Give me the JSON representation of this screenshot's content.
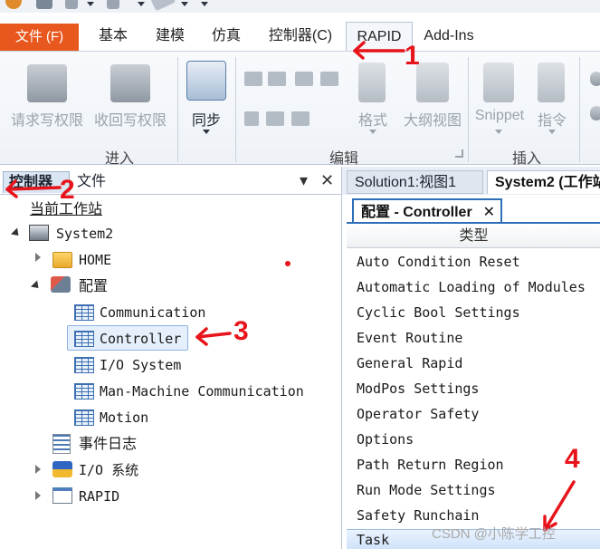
{
  "ribbon_tabs": {
    "file": "文件 (F)",
    "home": "基本",
    "modeling": "建模",
    "simulation": "仿真",
    "controller": "控制器(C)",
    "rapid": "RAPID",
    "addins": "Add-Ins"
  },
  "ribbon": {
    "request_write": "请求写权限",
    "release_write": "收回写权限",
    "sync": "同步",
    "format": "格式",
    "outline": "大纲视图",
    "snippet": "Snippet",
    "instruction": "指令",
    "groups": {
      "access": "进入",
      "edit": "编辑",
      "insert": "插入"
    }
  },
  "left_panel": {
    "tabs": [
      "控制器",
      "文件"
    ],
    "pin": "▾",
    "close": "✕",
    "tree": {
      "current_station": "当前工作站",
      "system": "System2",
      "home": "HOME",
      "config": "配置",
      "config_items": [
        "Communication",
        "Controller",
        "I/O System",
        "Man-Machine Communication",
        "Motion"
      ],
      "event_log": "事件日志",
      "io_system": "I/O 系统",
      "rapid": "RAPID"
    }
  },
  "right_panel": {
    "tabs": [
      "Solution1:视图1",
      "System2 (工作站"
    ],
    "doc_tab": "配置 - Controller",
    "doc_close": "✕",
    "column_header": "类型",
    "types": [
      "Auto Condition Reset",
      "Automatic Loading of Modules",
      "Cyclic Bool Settings",
      "Event Routine",
      "General Rapid",
      "ModPos Settings",
      "Operator Safety",
      "Options",
      "Path Return Region",
      "Run Mode Settings",
      "Safety Runchain",
      "Task"
    ]
  },
  "annotations": [
    "1",
    "2",
    "3",
    "4"
  ],
  "watermark": "CSDN @小陈学工控",
  "colors": {
    "file_tab": "#e8571d",
    "selection": "#e6f0fc",
    "active_doc": "#2c6fb8",
    "annotation_red": "#e8141b"
  }
}
